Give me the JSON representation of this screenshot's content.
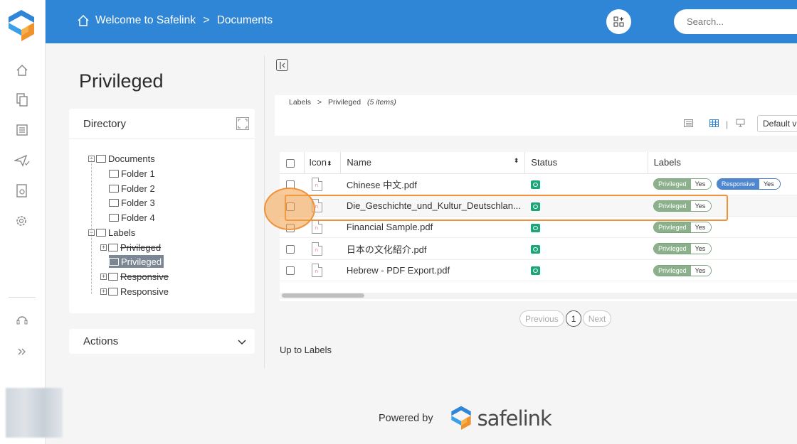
{
  "header": {
    "breadcrumb": [
      "Welcome to Safelink",
      ">",
      "Documents"
    ],
    "search_placeholder": "Search..."
  },
  "left": {
    "page_title": "Privileged",
    "directory_title": "Directory",
    "tree": [
      {
        "label": "Documents"
      },
      {
        "label": "Folder 1"
      },
      {
        "label": "Folder 2"
      },
      {
        "label": "Folder 3"
      },
      {
        "label": "Folder 4"
      },
      {
        "label": "Labels"
      },
      {
        "label": "Privileged"
      },
      {
        "label": "Privileged"
      },
      {
        "label": "Responsive"
      },
      {
        "label": "Responsive"
      }
    ],
    "actions_title": "Actions"
  },
  "main": {
    "crumbs": [
      "Labels",
      ">",
      "Privileged"
    ],
    "item_count": "(5 items)",
    "default_view": "Default vi",
    "columns": [
      "Icon",
      "Name",
      "Status",
      "Labels"
    ],
    "rows": [
      {
        "name": "Chinese 中文.pdf",
        "labels": [
          {
            "k": "Privileged",
            "v": "Yes"
          },
          {
            "k": "Responsive",
            "v": "Yes"
          }
        ]
      },
      {
        "name": "Die_Geschichte_und_Kultur_Deutschlan...",
        "labels": [
          {
            "k": "Privileged",
            "v": "Yes"
          }
        ]
      },
      {
        "name": "Financial Sample.pdf",
        "labels": [
          {
            "k": "Privileged",
            "v": "Yes"
          }
        ]
      },
      {
        "name": "日本の文化紹介.pdf",
        "labels": [
          {
            "k": "Privileged",
            "v": "Yes"
          }
        ]
      },
      {
        "name": "Hebrew - PDF Export.pdf",
        "labels": [
          {
            "k": "Privileged",
            "v": "Yes"
          }
        ]
      }
    ],
    "pager": {
      "prev": "Previous",
      "current": "1",
      "next": "Next"
    },
    "up_link": "Up to Labels"
  },
  "footer": {
    "powered_by": "Powered by",
    "brand": "safelink"
  },
  "colors": {
    "header_blue": "#2f86d6",
    "label_green": "#8cb08c",
    "label_blue": "#4e86cf",
    "highlight_orange": "#f0923a"
  }
}
